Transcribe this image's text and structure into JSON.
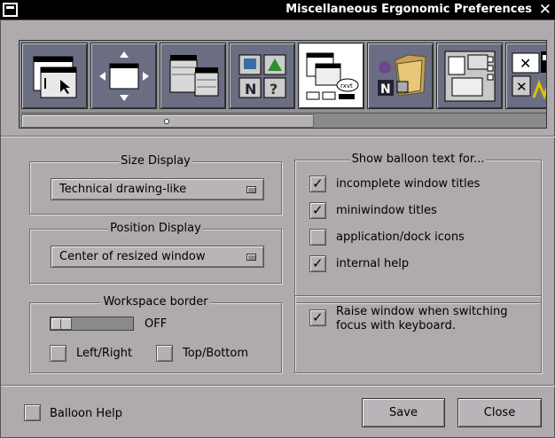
{
  "window": {
    "title": "Miscellaneous Ergonomic Preferences"
  },
  "icon_tiles": [
    {
      "name": "window-handling-icon"
    },
    {
      "name": "window-placement-icon"
    },
    {
      "name": "menu-preferences-icon"
    },
    {
      "name": "icon-preferences-icon"
    },
    {
      "name": "ergonomic-preferences-icon",
      "selected": true
    },
    {
      "name": "search-path-icon"
    },
    {
      "name": "workspace-preferences-icon"
    },
    {
      "name": "other-preferences-icon"
    }
  ],
  "size_display": {
    "legend": "Size Display",
    "value": "Technical drawing-like"
  },
  "position_display": {
    "legend": "Position Display",
    "value": "Center of resized window"
  },
  "workspace_border": {
    "legend": "Workspace border",
    "slider_value": "OFF",
    "left_right": {
      "label": "Left/Right",
      "checked": false
    },
    "top_bottom": {
      "label": "Top/Bottom",
      "checked": false
    }
  },
  "balloon": {
    "legend": "Show balloon text for...",
    "items": [
      {
        "label": "incomplete window titles",
        "checked": true
      },
      {
        "label": "miniwindow titles",
        "checked": true
      },
      {
        "label": "application/dock icons",
        "checked": false
      },
      {
        "label": "internal help",
        "checked": true
      }
    ]
  },
  "raise_window": {
    "line1": "Raise window when switching",
    "line2": "focus with keyboard.",
    "checked": true
  },
  "balloon_help": {
    "label": "Balloon Help",
    "checked": false
  },
  "buttons": {
    "save": "Save",
    "close": "Close"
  },
  "check_glyph": "✓"
}
